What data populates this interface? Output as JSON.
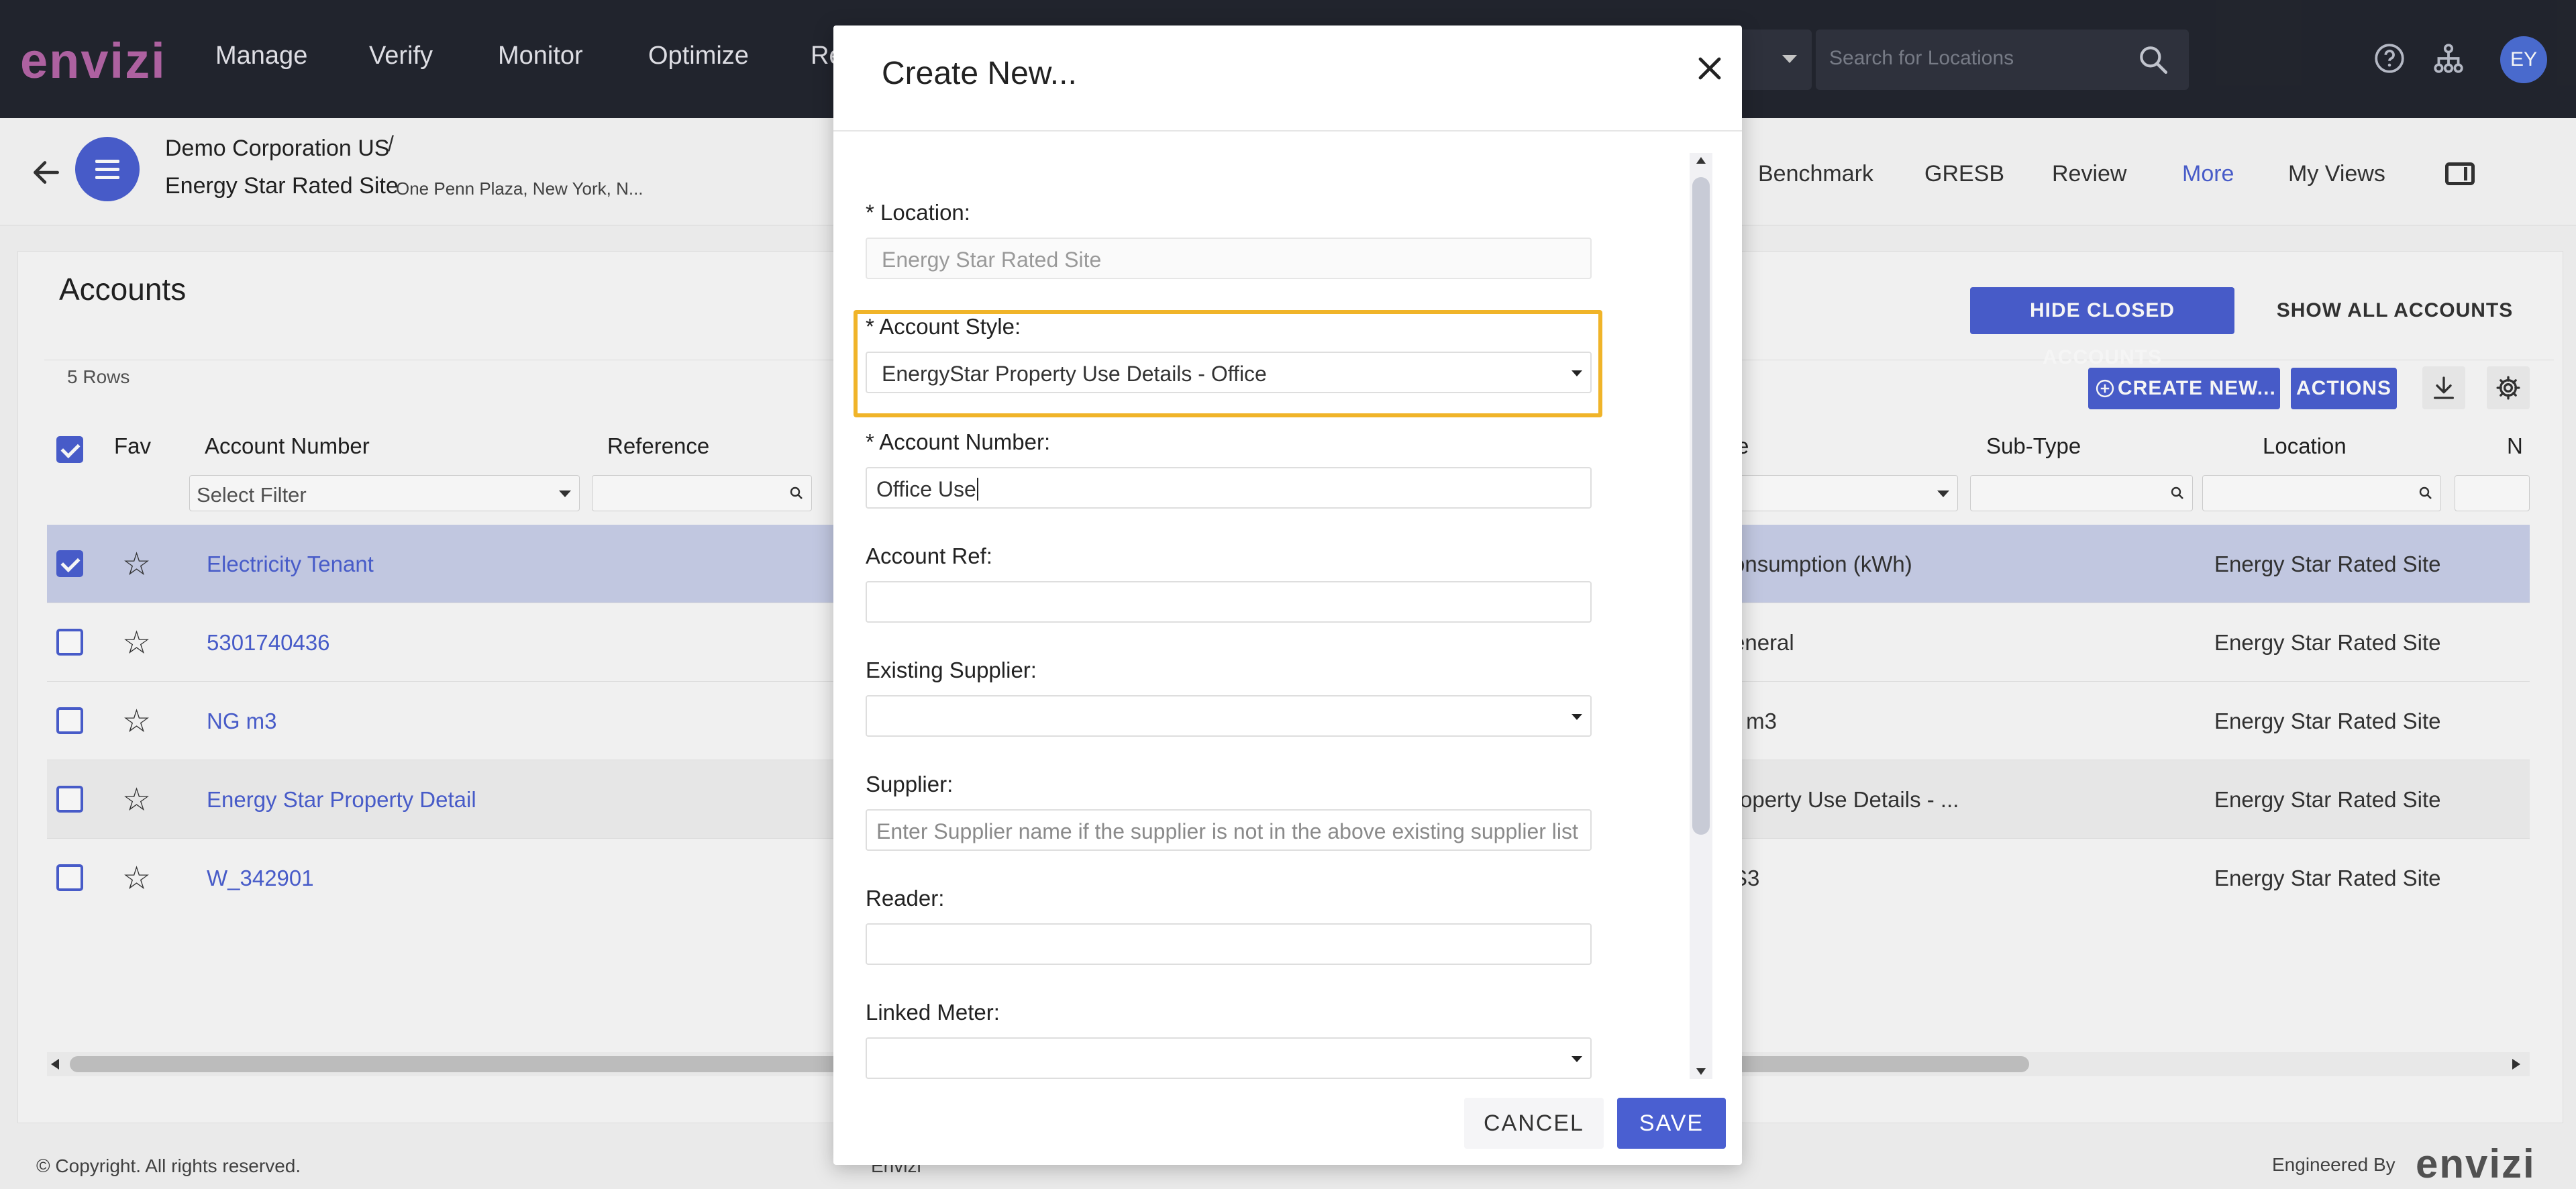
{
  "app": {
    "logo_text": "envizi",
    "nav": [
      "Manage",
      "Verify",
      "Monitor",
      "Optimize",
      "Re"
    ],
    "search_placeholder": "Search for Locations",
    "user_initials": "EY"
  },
  "context": {
    "org": "Demo Corporation US",
    "separator": "/",
    "site": "Energy Star Rated Site",
    "address": "One Penn Plaza, New York, N...",
    "tabs": [
      "Benchmark",
      "GRESB",
      "Review",
      "More",
      "My Views"
    ],
    "active_tab": "More"
  },
  "accounts": {
    "title": "Accounts",
    "rows_count": "5 Rows",
    "hide_closed_label": "HIDE CLOSED ACCOUNTS",
    "show_all_label": "SHOW ALL ACCOUNTS",
    "create_new_label": "CREATE NEW...",
    "actions_label": "ACTIONS",
    "columns": {
      "fav": "Fav",
      "account_number": "Account Number",
      "reference": "Reference",
      "type_partial": "e",
      "sub_type": "Sub-Type",
      "location": "Location",
      "next_partial": "N"
    },
    "filter_placeholder": "Select Filter",
    "rows": [
      {
        "account": "Electricity Tenant",
        "type": "onsumption (kWh)",
        "location": "Energy Star Rated Site",
        "checked": true
      },
      {
        "account": "5301740436",
        "type": "eneral",
        "location": "Energy Star Rated Site",
        "checked": false
      },
      {
        "account": "NG m3",
        "type": "- m3",
        "location": "Energy Star Rated Site",
        "checked": false
      },
      {
        "account": "Energy Star Property Detail",
        "type": "roperty Use Details - ...",
        "location": "Energy Star Rated Site",
        "checked": false
      },
      {
        "account": "W_342901",
        "type": "S3",
        "location": "Energy Star Rated Site",
        "checked": false
      }
    ]
  },
  "footer": {
    "copyright": "© Copyright. All rights reserved.",
    "middle": "Envizi",
    "engineered_by": "Engineered By",
    "logo_text": "envizi"
  },
  "modal": {
    "title": "Create New...",
    "location_label": "* Location:",
    "location_value": "Energy Star Rated Site",
    "account_style_label": "* Account Style:",
    "account_style_value": "EnergyStar Property Use Details - Office",
    "account_number_label": "* Account Number:",
    "account_number_value": "Office Use",
    "account_ref_label": "Account Ref:",
    "existing_supplier_label": "Existing Supplier:",
    "supplier_label": "Supplier:",
    "supplier_placeholder": "Enter Supplier name if the supplier is not in the above existing supplier list",
    "reader_label": "Reader:",
    "linked_meter_label": "Linked Meter:",
    "cancel_label": "CANCEL",
    "save_label": "SAVE"
  },
  "colors": {
    "accent": "#4a5fd1",
    "topnav_bg": "#23262f",
    "highlight": "#f0b429",
    "selected_row": "#c9d0ea"
  }
}
